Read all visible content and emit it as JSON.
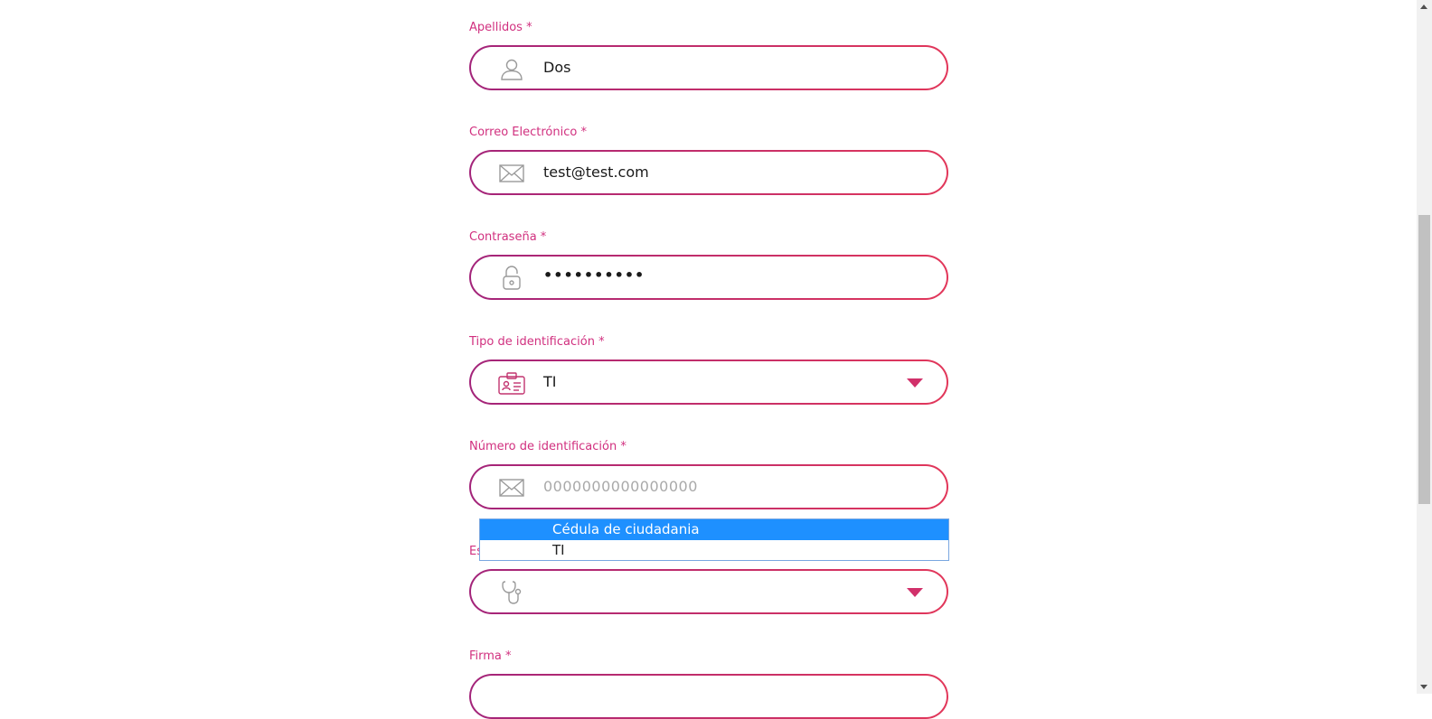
{
  "form": {
    "fields": [
      {
        "label": "Apellidos *",
        "value": "Dos",
        "icon": "user-icon"
      },
      {
        "label": "Correo Electrónico *",
        "value": "test@test.com",
        "icon": "mail-icon"
      },
      {
        "label": "Contraseña *",
        "value": "••••••••••",
        "icon": "lock-icon"
      },
      {
        "label": "Tipo de identificación *",
        "value": "TI",
        "icon": "id-card-icon"
      },
      {
        "label": "Número de identificación *",
        "placeholder": "0000000000000000",
        "icon": "mail-icon"
      },
      {
        "label": "Es",
        "value": "",
        "icon": "stethoscope-icon"
      },
      {
        "label": "Firma *",
        "value": ""
      }
    ]
  },
  "dropdown": {
    "options": [
      "Cédula de ciudadania",
      "TI"
    ],
    "highlighted": "Cédula de ciudadania"
  },
  "colors": {
    "accent": "#d1307f",
    "border_start": "#a3247a",
    "border_end": "#e2375a",
    "selection": "#1e90ff"
  }
}
